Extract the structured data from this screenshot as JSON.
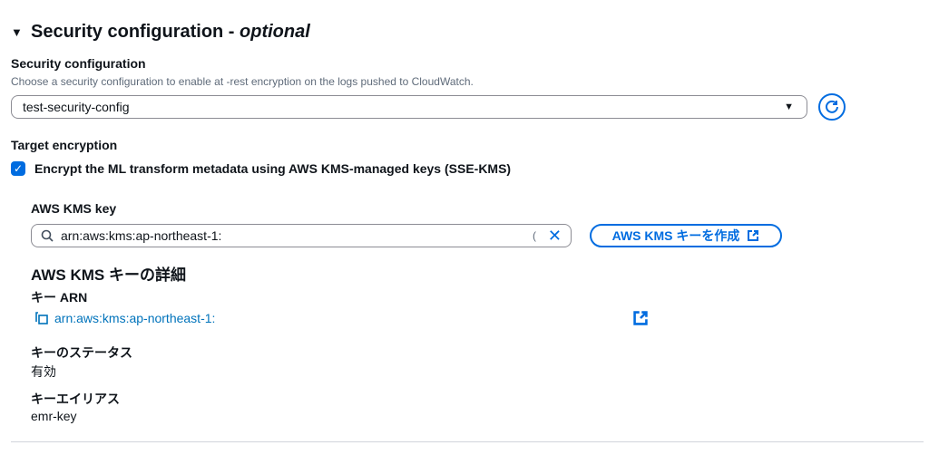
{
  "section": {
    "title": "Security configuration - ",
    "title_optional": "optional"
  },
  "security_config": {
    "label": "Security configuration",
    "description": "Choose a security configuration to enable at -rest encryption on the logs pushed to CloudWatch.",
    "selected_value": "test-security-config"
  },
  "target_encryption": {
    "label": "Target encryption",
    "checkbox_label": "Encrypt the ML transform metadata using AWS KMS-managed keys (SSE-KMS)",
    "checked": true
  },
  "kms": {
    "label": "AWS KMS key",
    "input_value": "arn:aws:kms:ap-northeast-1:",
    "truncation_mark": "(",
    "create_button_label": "AWS KMS キーを作成",
    "details_title": "AWS KMS キーの詳細",
    "arn_label": "キー ARN",
    "arn_value": "arn:aws:kms:ap-northeast-1:",
    "status_label": "キーのステータス",
    "status_value": "有効",
    "alias_label": "キーエイリアス",
    "alias_value": "emr-key"
  },
  "colors": {
    "accent": "#006ce0",
    "link": "#0073bb"
  }
}
